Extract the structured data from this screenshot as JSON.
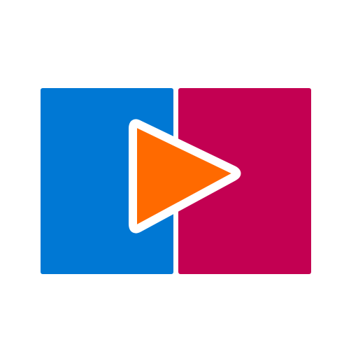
{
  "logo": {
    "icon": "play-button-logo-icon",
    "colors": {
      "left_panel": "#0078D4",
      "right_panel": "#C30052",
      "play_triangle": "#FF6A00",
      "outline": "#FFFFFF",
      "background": "#FFFFFF"
    }
  }
}
